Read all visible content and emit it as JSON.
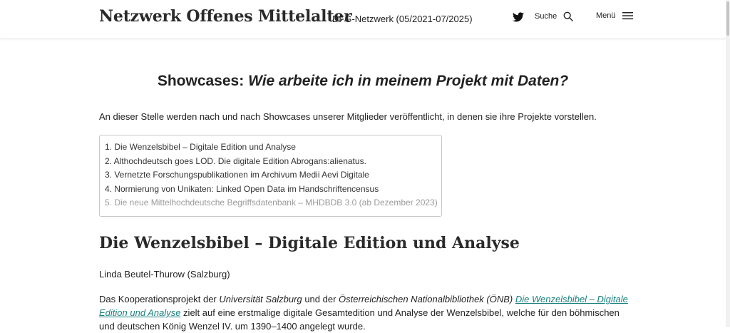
{
  "header": {
    "site_title": "Netzwerk Offenes Mittelalter",
    "site_subtitle": "DFG-Netzwerk (05/2021-07/2025)",
    "twitter_icon": "twitter-bird-icon",
    "search_label": "Suche",
    "search_icon": "search-icon",
    "menu_label": "Menü",
    "menu_icon": "hamburger-menu-icon"
  },
  "main": {
    "heading_prefix": "Showcases:",
    "heading_italic": "Wie arbeite ich in meinem Projekt mit Daten?",
    "intro": "An dieser Stelle werden nach und nach Showcases unserer Mitglieder veröffentlicht, in denen sie ihre Projekte vorstellen.",
    "toc": [
      {
        "label": "1. Die Wenzelsbibel – Digitale Edition und Analyse",
        "faded": false
      },
      {
        "label": "2. Althochdeutsch goes LOD. Die digitale Edition Abrogans:alienatus.",
        "faded": false
      },
      {
        "label": "3. Vernetzte Forschungspublikationen im Archivum Medii Aevi Digitale",
        "faded": false
      },
      {
        "label": "4. Normierung von Unikaten: Linked Open Data im Handschriftencensus",
        "faded": false
      },
      {
        "label": "5. Die neue Mittelhochdeutsche Begriffsdatenbank – MHDBDB 3.0 (ab Dezember 2023)",
        "faded": true
      }
    ],
    "section_heading": "Die Wenzelsbibel – Digitale Edition und Analyse",
    "author": "Linda Beutel-Thurow (Salzburg)",
    "paragraph": {
      "t1": "Das Kooperationsprojekt der ",
      "em1": "Universität Salzburg",
      "t2": " und der ",
      "em2": "Österreichischen Nationalbibliothek (ÖNB)",
      "t3": " ",
      "link": "Die Wenzelsbibel – Digitale Edition und Analyse",
      "t4": " zielt auf eine erstmalige digitale Gesamtedition und Analyse der Wenzelsbibel, welche für den böhmischen und deutschen König Wenzel IV. um 1390–1400 angelegt wurde."
    }
  },
  "colors": {
    "link": "#1a7f7f",
    "text": "#222222",
    "faded_toc": "#9a9a9a",
    "border": "#c8c8c8"
  }
}
